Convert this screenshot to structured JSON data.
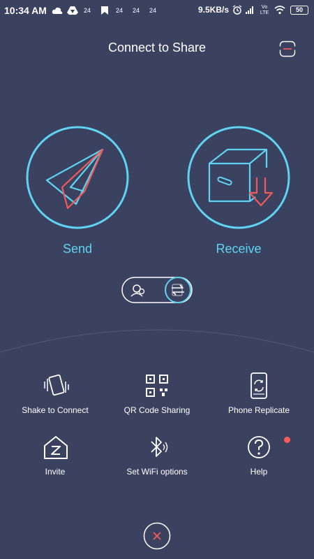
{
  "status_bar": {
    "time": "10:34 AM",
    "notif_counts": [
      "24",
      "24",
      "24",
      "24"
    ],
    "net_speed": "9.5KB/s",
    "volte": "Vo LTE",
    "battery": "50"
  },
  "header": {
    "title": "Connect to Share",
    "menu_icon": "hamburger-icon"
  },
  "actions": {
    "send_label": "Send",
    "receive_label": "Receive"
  },
  "grid": {
    "shake_label": "Shake to Connect",
    "qr_label": "QR Code Sharing",
    "replicate_label": "Phone Replicate",
    "invite_label": "Invite",
    "wifi_label": "Set WiFi options",
    "help_label": "Help"
  },
  "colors": {
    "background": "#3a4260",
    "accent": "#5fd4f2",
    "red": "#ff5a5a"
  }
}
